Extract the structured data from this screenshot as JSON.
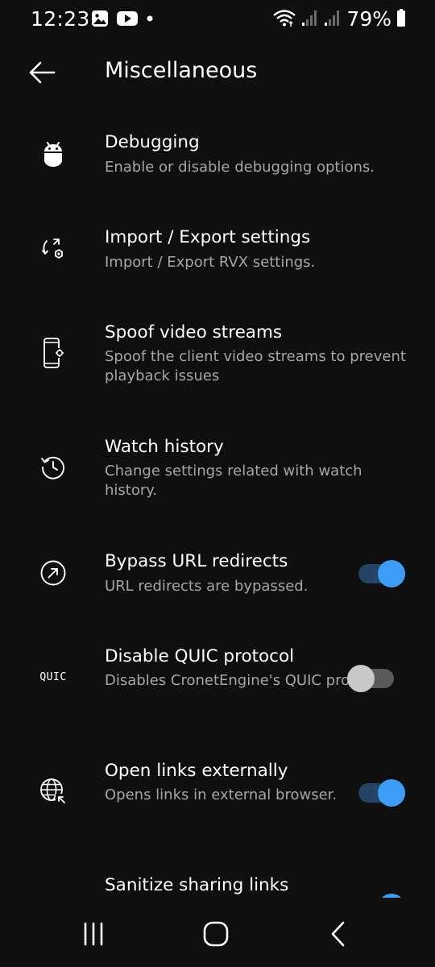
{
  "status_bar": {
    "time": "12:23",
    "battery": "79%",
    "left_icons": [
      "gallery-icon",
      "youtube-icon",
      "notification-dot-icon"
    ],
    "right_icons": [
      "wifi-icon",
      "signal-icon",
      "signal-icon",
      "battery-icon"
    ]
  },
  "header": {
    "title": "Miscellaneous",
    "back_icon": "back-arrow-icon"
  },
  "items": [
    {
      "title": "Debugging",
      "summary": "Enable or disable debugging options.",
      "icon": "android-icon"
    },
    {
      "title": "Import / Export settings",
      "summary": "Import / Export RVX settings.",
      "icon": "import-export-icon"
    },
    {
      "title": "Spoof video streams",
      "summary": "Spoof the client video streams to prevent playback issues",
      "icon": "phone-settings-icon"
    },
    {
      "title": "Watch history",
      "summary": "Change settings related with watch history.",
      "icon": "history-icon"
    },
    {
      "title": "Bypass URL redirects",
      "summary": "URL redirects are bypassed.",
      "icon": "arrow-circle-icon",
      "toggle": true
    },
    {
      "title": "Disable QUIC protocol",
      "summary": "Disables CronetEngine's QUIC protocol.",
      "icon": "quic-icon",
      "icon_text": "QUIC",
      "toggle": false
    },
    {
      "title": "Open links externally",
      "summary": "Opens links in external browser.",
      "icon": "globe-icon",
      "toggle": true
    },
    {
      "title": "Sanitize sharing links",
      "summary": "",
      "icon": "",
      "toggle": true
    }
  ],
  "colors": {
    "background": "#0f0f0f",
    "toggle_on_thumb": "#3d9df7",
    "toggle_on_track": "#244565",
    "toggle_off_thumb": "#c9c9c9",
    "toggle_off_track": "#5a5a5a",
    "summary_text": "#a6a6a6"
  },
  "nav_bar": {
    "recents_icon": "recents-icon",
    "home_icon": "home-icon",
    "back_icon": "nav-back-icon"
  }
}
